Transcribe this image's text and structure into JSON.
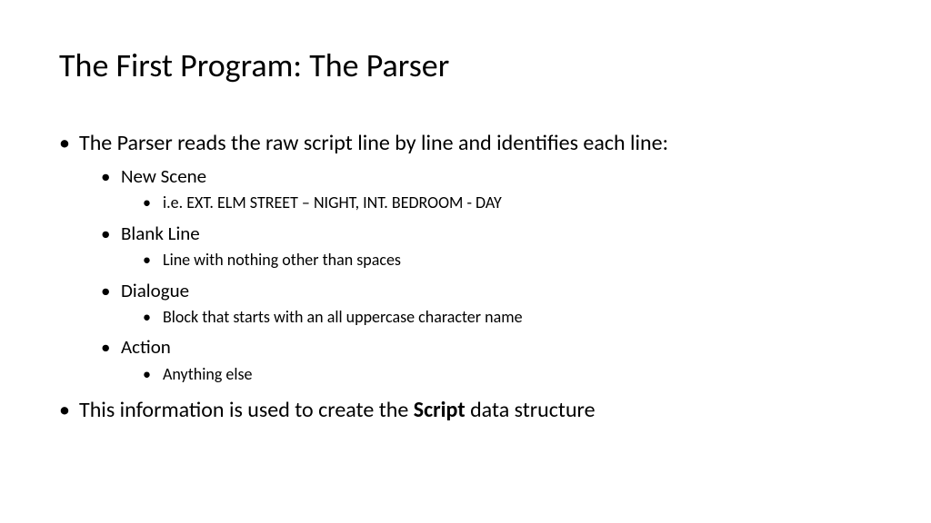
{
  "title": "The First Program: The Parser",
  "bullets": {
    "item1": "The Parser reads the raw script line by line and identifies each line:",
    "item1_1": "New Scene",
    "item1_1_1": "i.e. EXT. ELM STREET – NIGHT, INT. BEDROOM - DAY",
    "item1_2": "Blank Line",
    "item1_2_1": "Line with nothing other than spaces",
    "item1_3": "Dialogue",
    "item1_3_1": "Block that starts with an all uppercase character name",
    "item1_4": "Action",
    "item1_4_1": "Anything else",
    "item2_prefix": "This information is used to create the ",
    "item2_bold": "Script",
    "item2_suffix": " data structure"
  }
}
